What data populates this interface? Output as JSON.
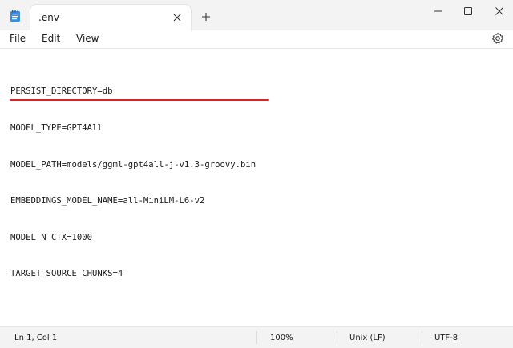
{
  "window": {
    "tab_title": ".env",
    "icons": {
      "app": "notepad-icon",
      "tab_close": "close-icon",
      "new_tab": "plus-icon",
      "minimize": "minimize-icon",
      "maximize": "maximize-icon",
      "close": "close-icon"
    }
  },
  "menu": {
    "file": "File",
    "edit": "Edit",
    "view": "View",
    "settings_icon": "gear-icon"
  },
  "editor": {
    "lines": [
      "PERSIST_DIRECTORY=db",
      "MODEL_TYPE=GPT4All",
      "MODEL_PATH=models/ggml-gpt4all-j-v1.3-groovy.bin",
      "EMBEDDINGS_MODEL_NAME=all-MiniLM-L6-v2",
      "MODEL_N_CTX=1000",
      "TARGET_SOURCE_CHUNKS=4"
    ],
    "highlight_color": "#d62424"
  },
  "status": {
    "position": "Ln 1, Col 1",
    "zoom": "100%",
    "line_ending": "Unix (LF)",
    "encoding": "UTF-8"
  }
}
